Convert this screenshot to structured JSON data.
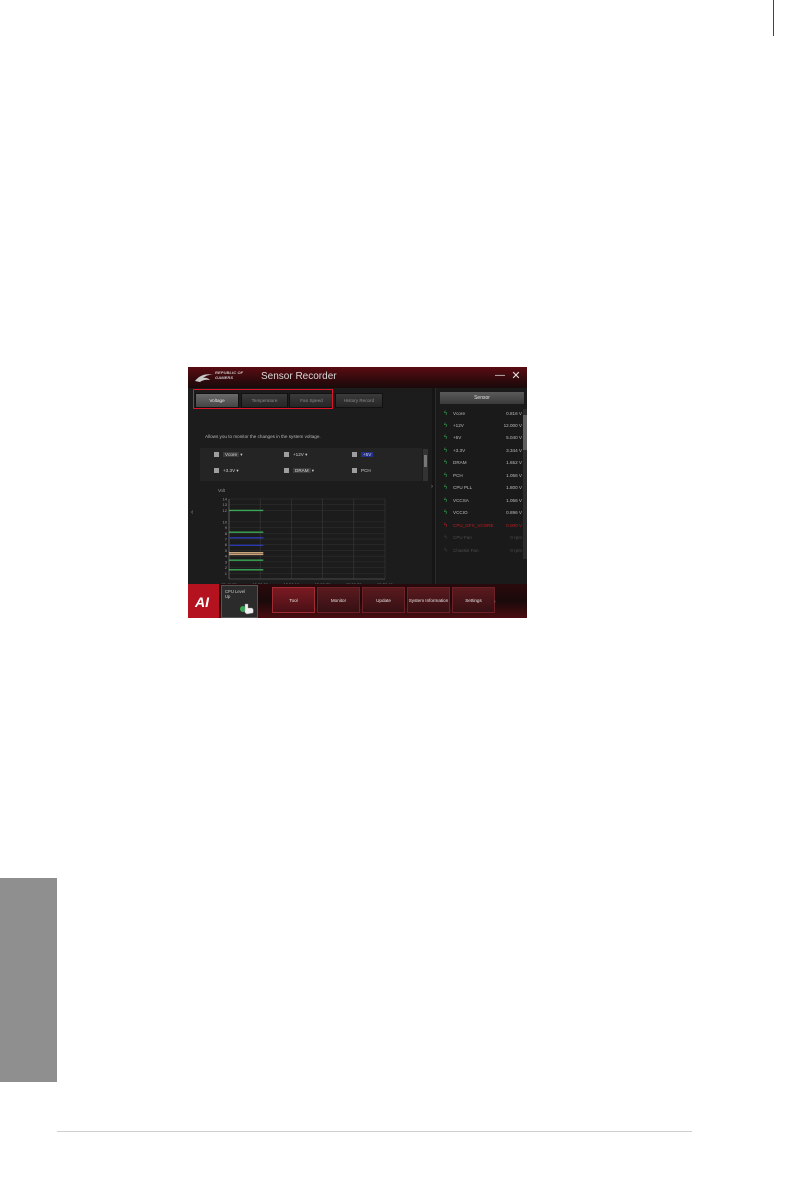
{
  "page": {
    "colors": {
      "accent_red": "#e0152a",
      "window_bg": "#151515",
      "side_tab": "#8f8f8f"
    }
  },
  "window": {
    "brand_line1": "REPUBLIC OF",
    "brand_line2": "GAMERS",
    "title": "Sensor Recorder",
    "minimize": "—",
    "close": "✕",
    "tabs": [
      "Voltage",
      "Temperature",
      "Fan Speed",
      "History Record"
    ],
    "description": "Allows you to monitor the changes in the system voltage.",
    "checks": [
      {
        "label": "Vcore",
        "selected": true
      },
      {
        "label": "+12V",
        "selected": false
      },
      {
        "label": "+5V",
        "selected": true
      },
      {
        "label": "+3.3V",
        "selected": false
      },
      {
        "label": "DRAM",
        "selected": false
      },
      {
        "label": "PCH",
        "selected": true
      }
    ],
    "time_label": "(Time)",
    "controls": "↶  ⌕  ⌕  100%   ⌕  ⌕  100%",
    "left_arrow": "‹",
    "mid_arrow": "›",
    "sensor_header": "Sensor",
    "sensors": [
      {
        "name": "Vcore",
        "value": "0.816",
        "unit": "V"
      },
      {
        "name": "+12V",
        "value": "12.000",
        "unit": "V"
      },
      {
        "name": "+5V",
        "value": "5.040",
        "unit": "V"
      },
      {
        "name": "+3.3V",
        "value": "3.344",
        "unit": "V"
      },
      {
        "name": "DRAM",
        "value": "1.652",
        "unit": "V"
      },
      {
        "name": "PCH",
        "value": "1.056",
        "unit": "V"
      },
      {
        "name": "CPU PLL",
        "value": "1.800",
        "unit": "V"
      },
      {
        "name": "VCCSA",
        "value": "1.056",
        "unit": "V"
      },
      {
        "name": "VCCIO",
        "value": "0.896",
        "unit": "V"
      },
      {
        "name": "CPU_GFX_VCORE",
        "value": "0.000",
        "unit": "V"
      },
      {
        "name": "CPU Fan",
        "value": "0",
        "unit": "rpm"
      },
      {
        "name": "Chassis Fan",
        "value": "0",
        "unit": "rpm"
      }
    ],
    "cpu_label_1": "CPU Level",
    "cpu_label_2": "Up",
    "buttons": [
      "Tool",
      "Monitor",
      "Update",
      "System Information",
      "Settings"
    ],
    "bar_end": "›"
  },
  "chart_data": {
    "type": "line",
    "ylabel": "Volt",
    "yticks": [
      "14",
      "13",
      "12",
      "10",
      "9",
      "8",
      "7",
      "6",
      "5",
      "4",
      "3",
      "2",
      "1"
    ],
    "x": [
      "15:49:59",
      "15:50:09",
      "15:50:19",
      "15:50:29",
      "15:50:39",
      "15:50:49"
    ],
    "series": [
      {
        "color": "#3aa856",
        "y": 12
      },
      {
        "color": "#3aa856",
        "y": 8.2
      },
      {
        "color": "#2a3bb0",
        "y": 7.2
      },
      {
        "color": "#2a3bb0",
        "y": 5.9
      },
      {
        "color": "#c8a27a",
        "y": 4.6
      },
      {
        "color": "#c8a27a",
        "y": 4.3
      },
      {
        "color": "#3aa856",
        "y": 3.3
      },
      {
        "color": "#3aa856",
        "y": 1.6
      }
    ]
  }
}
